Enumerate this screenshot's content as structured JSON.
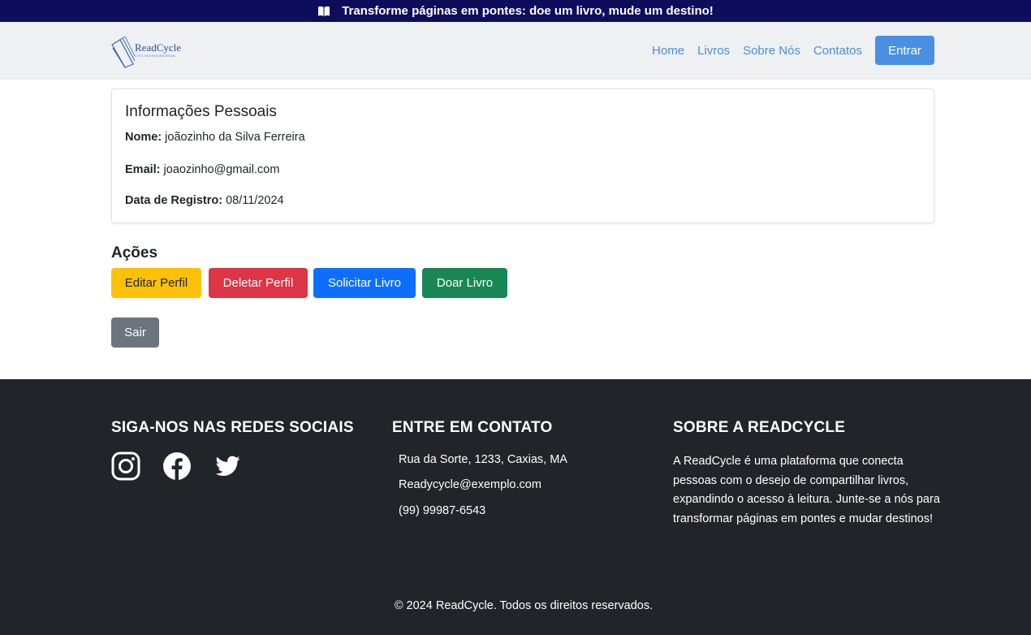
{
  "banner": {
    "text": "Transforme páginas em pontes: doe um livro, mude um destino!",
    "icon": "open-book-icon"
  },
  "navbar": {
    "logo": {
      "name": "ReadCycle",
      "tagline": "CYCLING KNOWLEDGE"
    },
    "links": [
      "Home",
      "Livros",
      "Sobre Nós",
      "Contatos"
    ],
    "login_label": "Entrar"
  },
  "profile": {
    "title": "Informações Pessoais",
    "nome_label": "Nome:",
    "nome_value": "joãozinho da Silva Ferreira",
    "email_label": "Email:",
    "email_value": "joaozinho@gmail.com",
    "registro_label": "Data de Registro:",
    "registro_value": "08/11/2024"
  },
  "actions": {
    "title": "Ações",
    "edit": "Editar Perfil",
    "delete": "Deletar Perfil",
    "request": "Solicitar Livro",
    "donate": "Doar Livro",
    "logout": "Sair"
  },
  "footer": {
    "social_title": "SIGA-NOS NAS REDES SOCIAIS",
    "social_icons": [
      "instagram-icon",
      "facebook-icon",
      "twitter-icon"
    ],
    "contact_title": "ENTRE EM CONTATO",
    "address": "Rua da Sorte, 1233, Caxias, MA",
    "email": "Readycycle@exemplo.com",
    "phone": "(99) 99987-6543",
    "about_title": "SOBRE A READCYCLE",
    "about_text": "A ReadCycle é uma plataforma que conecta pessoas com o desejo de compartilhar livros, expandindo o acesso à leitura. Junte-se a nós para transformar páginas em pontes e mudar destinos!",
    "copyright": "© 2024 ReadCycle. Todos os direitos reservados."
  },
  "colors": {
    "banner_bg": "#0d0d5c",
    "navbar_bg": "#eef0f2",
    "nav_link": "#4a90d9",
    "warning": "#ffc107",
    "danger": "#dc3545",
    "primary": "#0d6efd",
    "success": "#198754",
    "secondary": "#6c757d",
    "footer_bg": "#212529"
  }
}
